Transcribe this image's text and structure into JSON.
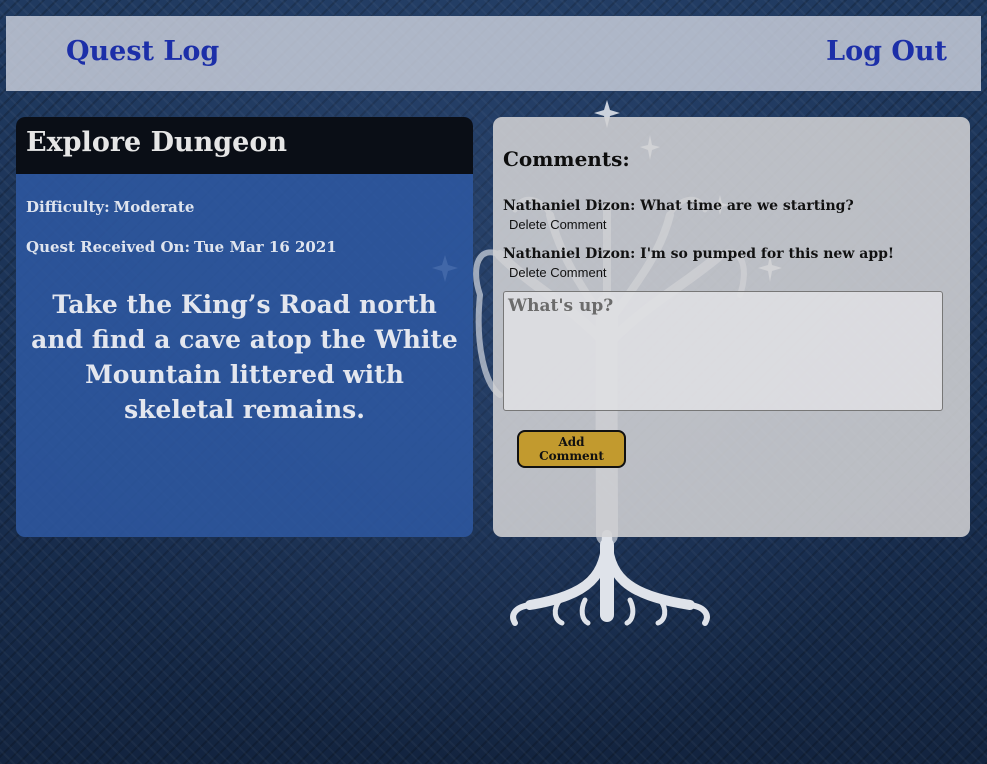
{
  "nav": {
    "home_label": "Quest Log",
    "logout_label": "Log Out"
  },
  "quest": {
    "title": "Explore Dungeon",
    "difficulty_label": "Difficulty:",
    "difficulty": "Moderate",
    "received_label": "Quest Received On:",
    "received_date": "Tue Mar 16 2021",
    "description": "Take the King’s Road north and find a cave atop the White Mountain littered with skeletal remains."
  },
  "comments": {
    "heading": "Comments:",
    "items": [
      {
        "author": "Nathaniel Dizon",
        "text": "What time are we starting?",
        "delete_label": "Delete Comment"
      },
      {
        "author": "Nathaniel Dizon",
        "text": "I'm so pumped for this new app!",
        "delete_label": "Delete Comment"
      }
    ],
    "input_placeholder": "What's up?",
    "add_label": "Add Comment"
  },
  "colors": {
    "accent_link": "#1c2fa8",
    "quest_panel": "#2e58a0",
    "add_button": "#c29a2e"
  }
}
